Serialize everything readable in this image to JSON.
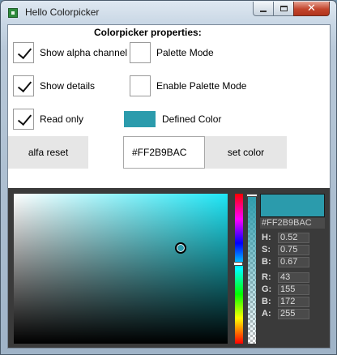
{
  "window": {
    "title": "Hello Colorpicker",
    "close_glyph": "✕"
  },
  "properties": {
    "heading": "Colorpicker properties:",
    "show_alpha": {
      "label": "Show alpha channel",
      "checked": true
    },
    "show_details": {
      "label": "Show details",
      "checked": true
    },
    "read_only": {
      "label": "Read only",
      "checked": true
    },
    "palette_mode": {
      "label": "Palette Mode",
      "checked": false
    },
    "enable_palette_mode": {
      "label": "Enable Palette Mode",
      "checked": false
    },
    "defined_color": {
      "label": "Defined Color",
      "color": "#2B9BAC"
    }
  },
  "actions": {
    "alfa_reset_label": "alfa reset",
    "hex_value": "#FF2B9BAC",
    "set_color_label": "set color"
  },
  "picker": {
    "current_color": "#2B9BAC",
    "hex_readout": "#FF2B9BAC",
    "hsb": [
      {
        "label": "H:",
        "value": "0.52"
      },
      {
        "label": "S:",
        "value": "0.75"
      },
      {
        "label": "B:",
        "value": "0.67"
      }
    ],
    "rgba": [
      {
        "label": "R:",
        "value": "43"
      },
      {
        "label": "G:",
        "value": "155"
      },
      {
        "label": "B:",
        "value": "172"
      },
      {
        "label": "A:",
        "value": "255"
      }
    ]
  }
}
